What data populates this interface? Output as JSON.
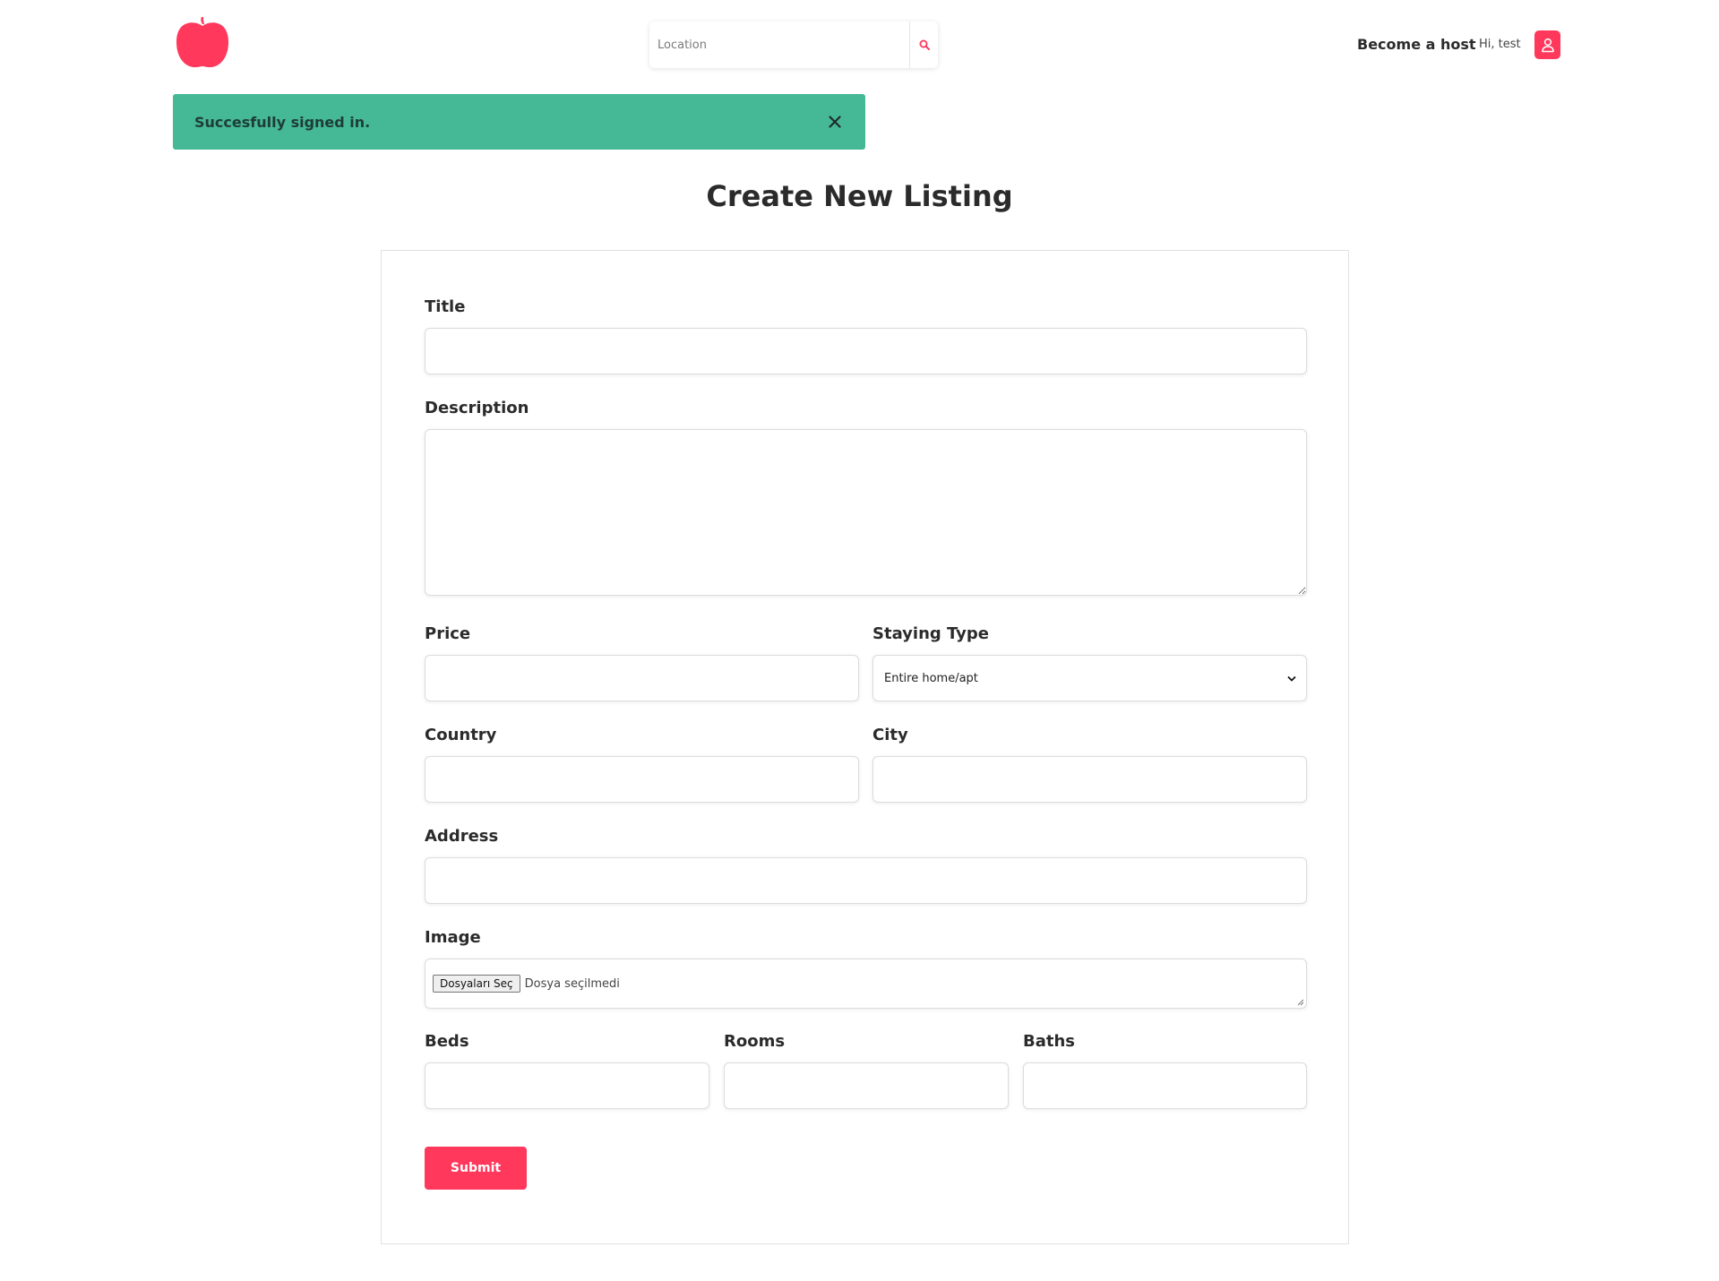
{
  "header": {
    "logo_icon": "apple-logo-icon",
    "search_placeholder": "Location",
    "search_icon": "search-icon",
    "become_host": "Become a host",
    "greeting": "Hi, test",
    "user_icon": "user-icon"
  },
  "alert": {
    "message": "Succesfully signed in.",
    "close_icon": "close-icon"
  },
  "page_title": "Create New Listing",
  "form": {
    "title_label": "Title",
    "description_label": "Description",
    "price_label": "Price",
    "staying_type_label": "Staying Type",
    "staying_type_value": "Entire home/apt",
    "country_label": "Country",
    "city_label": "City",
    "address_label": "Address",
    "image_label": "Image",
    "file_button": "Dosyaları Seç",
    "file_status": "Dosya seçilmedi",
    "beds_label": "Beds",
    "rooms_label": "Rooms",
    "baths_label": "Baths",
    "submit": "Submit"
  },
  "colors": {
    "brand": "#ff385c",
    "alert_bg": "#45b995"
  }
}
